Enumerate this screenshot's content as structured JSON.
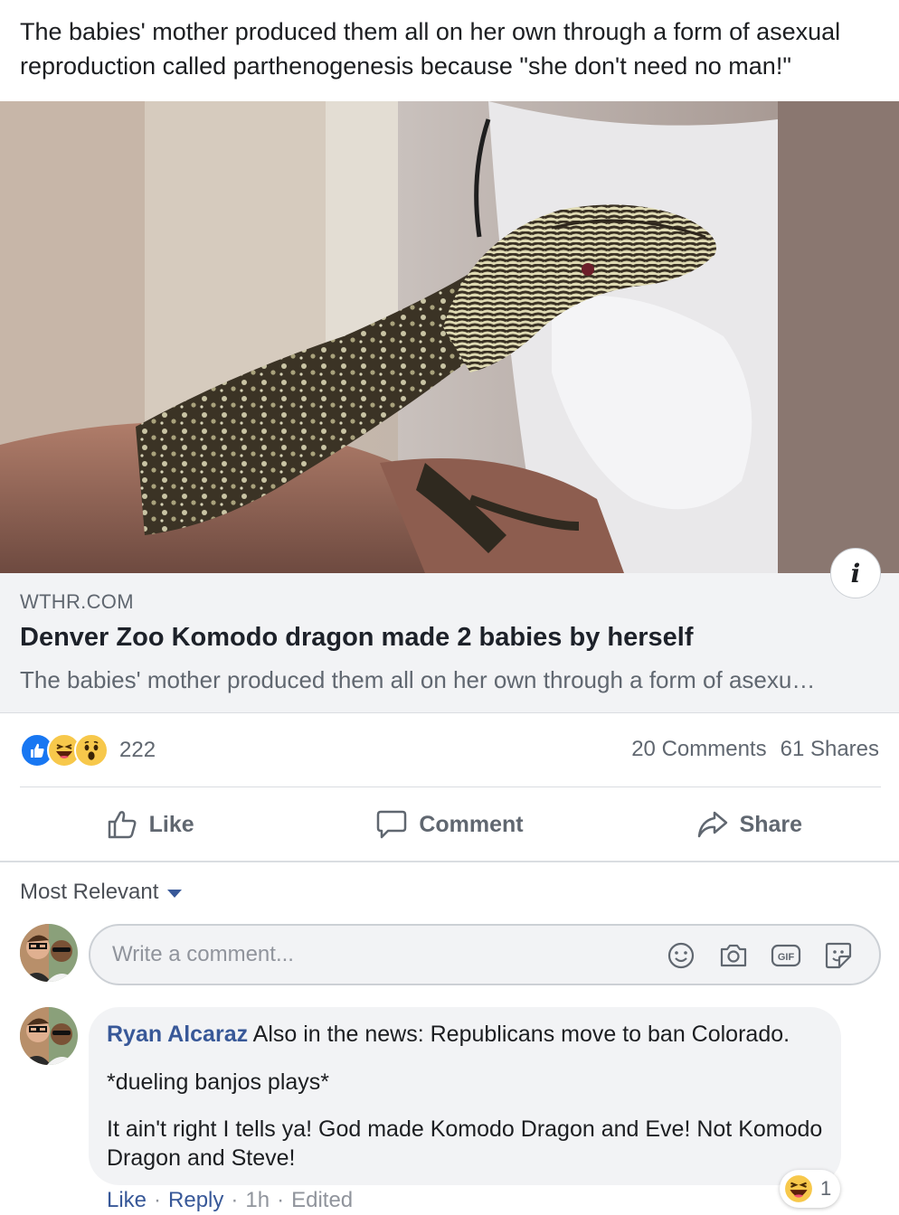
{
  "post": {
    "text": "The babies' mother produced them all on her own through a form of asexual reproduction called parthenogenesis because \"she don't need no man!\""
  },
  "link": {
    "domain": "WTHR.COM",
    "title": "Denver Zoo Komodo dragon made 2 babies by herself",
    "description": "The babies' mother produced them all on her own through a form of asexu…",
    "info_icon": "i"
  },
  "reactions": {
    "types": [
      "like",
      "haha",
      "wow"
    ],
    "count": "222",
    "comments": "20 Comments",
    "shares": "61 Shares"
  },
  "actions": {
    "like": "Like",
    "comment": "Comment",
    "share": "Share"
  },
  "comments_section": {
    "sort_label": "Most Relevant",
    "input_placeholder": "Write a comment...",
    "input_icons": [
      "emoji-icon",
      "camera-icon",
      "gif-icon",
      "sticker-icon"
    ]
  },
  "comment": {
    "author": "Ryan Alcaraz",
    "line1": "Also in the news: Republicans move to ban Colorado.",
    "line2": "*dueling banjos plays*",
    "line3": "It ain't right I tells ya! God made Komodo Dragon and Eve! Not Komodo Dragon and Steve!",
    "like": "Like",
    "reply": "Reply",
    "time": "1h",
    "edited": "Edited",
    "reaction_count": "1"
  },
  "colors": {
    "link_blue": "#385898",
    "like_blue": "#1877f2",
    "emoji_yellow": "#f7c84b",
    "muted": "#606770"
  }
}
